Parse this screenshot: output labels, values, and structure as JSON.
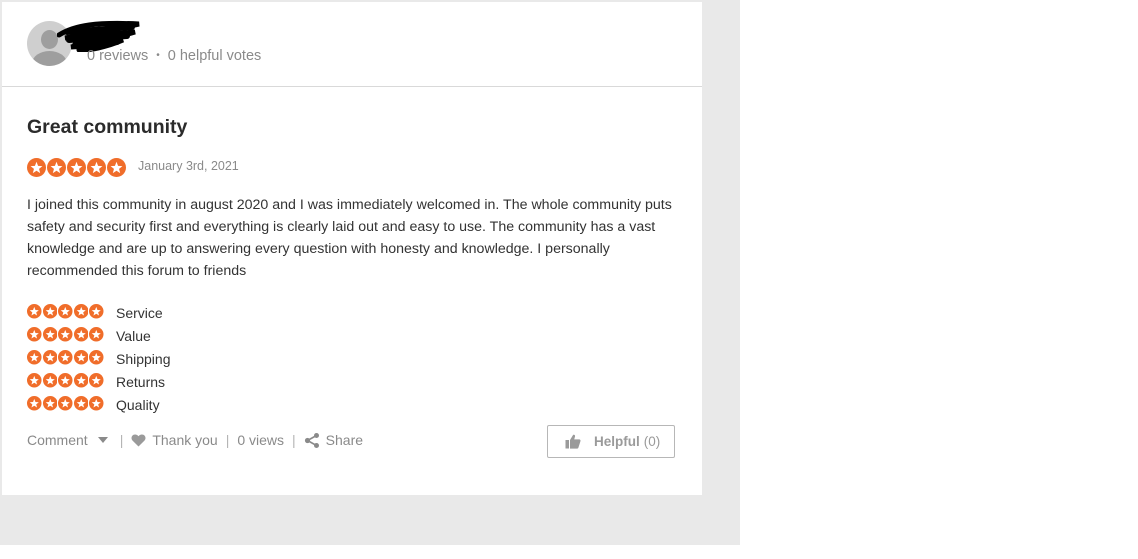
{
  "reviewer": {
    "reviews": "0 reviews",
    "separator": "•",
    "helpful_votes": "0 helpful votes"
  },
  "review": {
    "title": "Great community",
    "rating": 5,
    "date": "January 3rd, 2021",
    "body": "I joined this community in august 2020 and I was immediately welcomed in. The whole community puts safety and security first and everything is clearly laid out and easy to use. The community has a vast knowledge and are up to answering every question with honesty and knowledge. I personally recommended this forum to friends",
    "criteria": [
      {
        "label": "Service",
        "rating": 5
      },
      {
        "label": "Value",
        "rating": 5
      },
      {
        "label": "Shipping",
        "rating": 5
      },
      {
        "label": "Returns",
        "rating": 5
      },
      {
        "label": "Quality",
        "rating": 5
      }
    ]
  },
  "actions": {
    "comment": "Comment",
    "divider": "|",
    "thank_you": "Thank you",
    "views": "0 views",
    "share": "Share"
  },
  "helpful": {
    "label": "Helpful",
    "count": "(0)"
  },
  "colors": {
    "star": "#f06d2a",
    "muted_text": "#8a8a8a",
    "body_text": "#333333"
  },
  "icons": {
    "avatar": "person-silhouette-icon",
    "star": "star-icon",
    "caret": "chevron-down-icon",
    "heart": "heart-icon",
    "share": "share-icon",
    "thumb": "thumbs-up-icon"
  }
}
